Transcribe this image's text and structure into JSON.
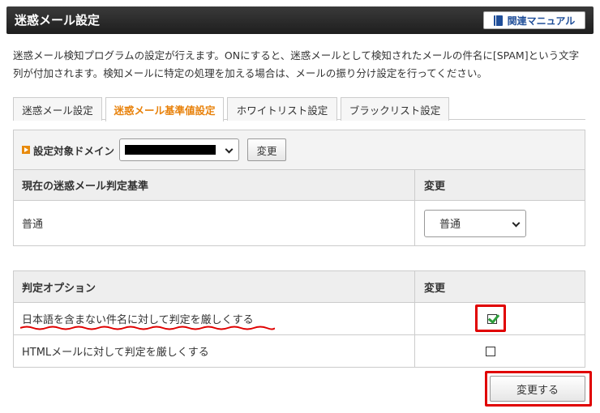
{
  "header": {
    "title": "迷惑メール設定",
    "manual_label": "関連マニュアル"
  },
  "description": "迷惑メール検知プログラムの設定が行えます。ONにすると、迷惑メールとして検知されたメールの件名に[SPAM]という文字列が付加されます。検知メールに特定の処理を加える場合は、メールの振り分け設定を行ってください。",
  "tabs": [
    {
      "label": "迷惑メール設定",
      "active": false
    },
    {
      "label": "迷惑メール基準値設定",
      "active": true
    },
    {
      "label": "ホワイトリスト設定",
      "active": false
    },
    {
      "label": "ブラックリスト設定",
      "active": false
    }
  ],
  "domain": {
    "label": "設定対象ドメイン",
    "selected": "",
    "change_label": "変更"
  },
  "criteria": {
    "header_left": "現在の迷惑メール判定基準",
    "header_right": "変更",
    "current_value": "普通",
    "select_value": "普通"
  },
  "options": {
    "header_left": "判定オプション",
    "header_right": "変更",
    "items": [
      {
        "label": "日本語を含まない件名に対して判定を厳しくする",
        "checked": true
      },
      {
        "label": "HTMLメールに対して判定を厳しくする",
        "checked": false
      }
    ]
  },
  "submit_label": "変更する",
  "colors": {
    "accent_tab": "#e8820c",
    "highlight": "#e00000",
    "check": "#2e9e3c",
    "header_bg": "#2a2a2a"
  }
}
